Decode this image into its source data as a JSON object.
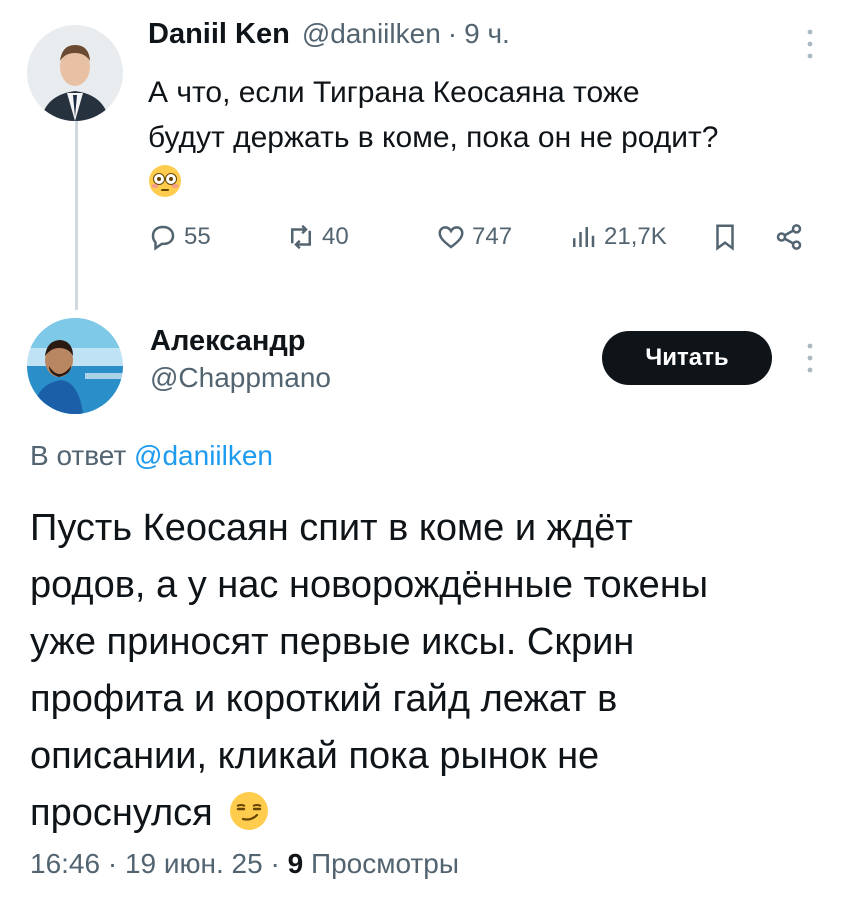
{
  "tweet1": {
    "author_name": "Daniil Ken",
    "handle": "@daniilken",
    "separator": "·",
    "time": "9 ч.",
    "text_lines": [
      "А что, если Тиграна Кеосаяна тоже",
      "будут держать в коме, пока он не родит?"
    ],
    "emoji_icon": "flushed-face-emoji",
    "actions": {
      "replies": "55",
      "reposts": "40",
      "likes": "747",
      "views": "21,7K"
    }
  },
  "tweet2": {
    "author_name": "Александр",
    "handle": "@Chappmano",
    "follow_label": "Читать",
    "reply_prefix": "В ответ",
    "reply_handle": "@daniilken",
    "text_lines": [
      "Пусть Кеосаян спит в коме и ждёт",
      "родов, а у нас новорождённые токены",
      "уже приносят первые иксы. Скрин",
      "профита и короткий гайд лежат в",
      "описании, кликай пока рынок не",
      "проснулся"
    ],
    "emoji_icon": "smirking-face-emoji",
    "meta": {
      "time": "16:46",
      "sep1": "·",
      "date": "19 июн. 25",
      "sep2": "·",
      "views_count": "9",
      "views_label": "Просмотры"
    }
  },
  "colors": {
    "text": "#0f1419",
    "secondary": "#536471",
    "link": "#1d9bf0",
    "thread_line": "#cfd9de",
    "button_bg": "#0f1419"
  }
}
